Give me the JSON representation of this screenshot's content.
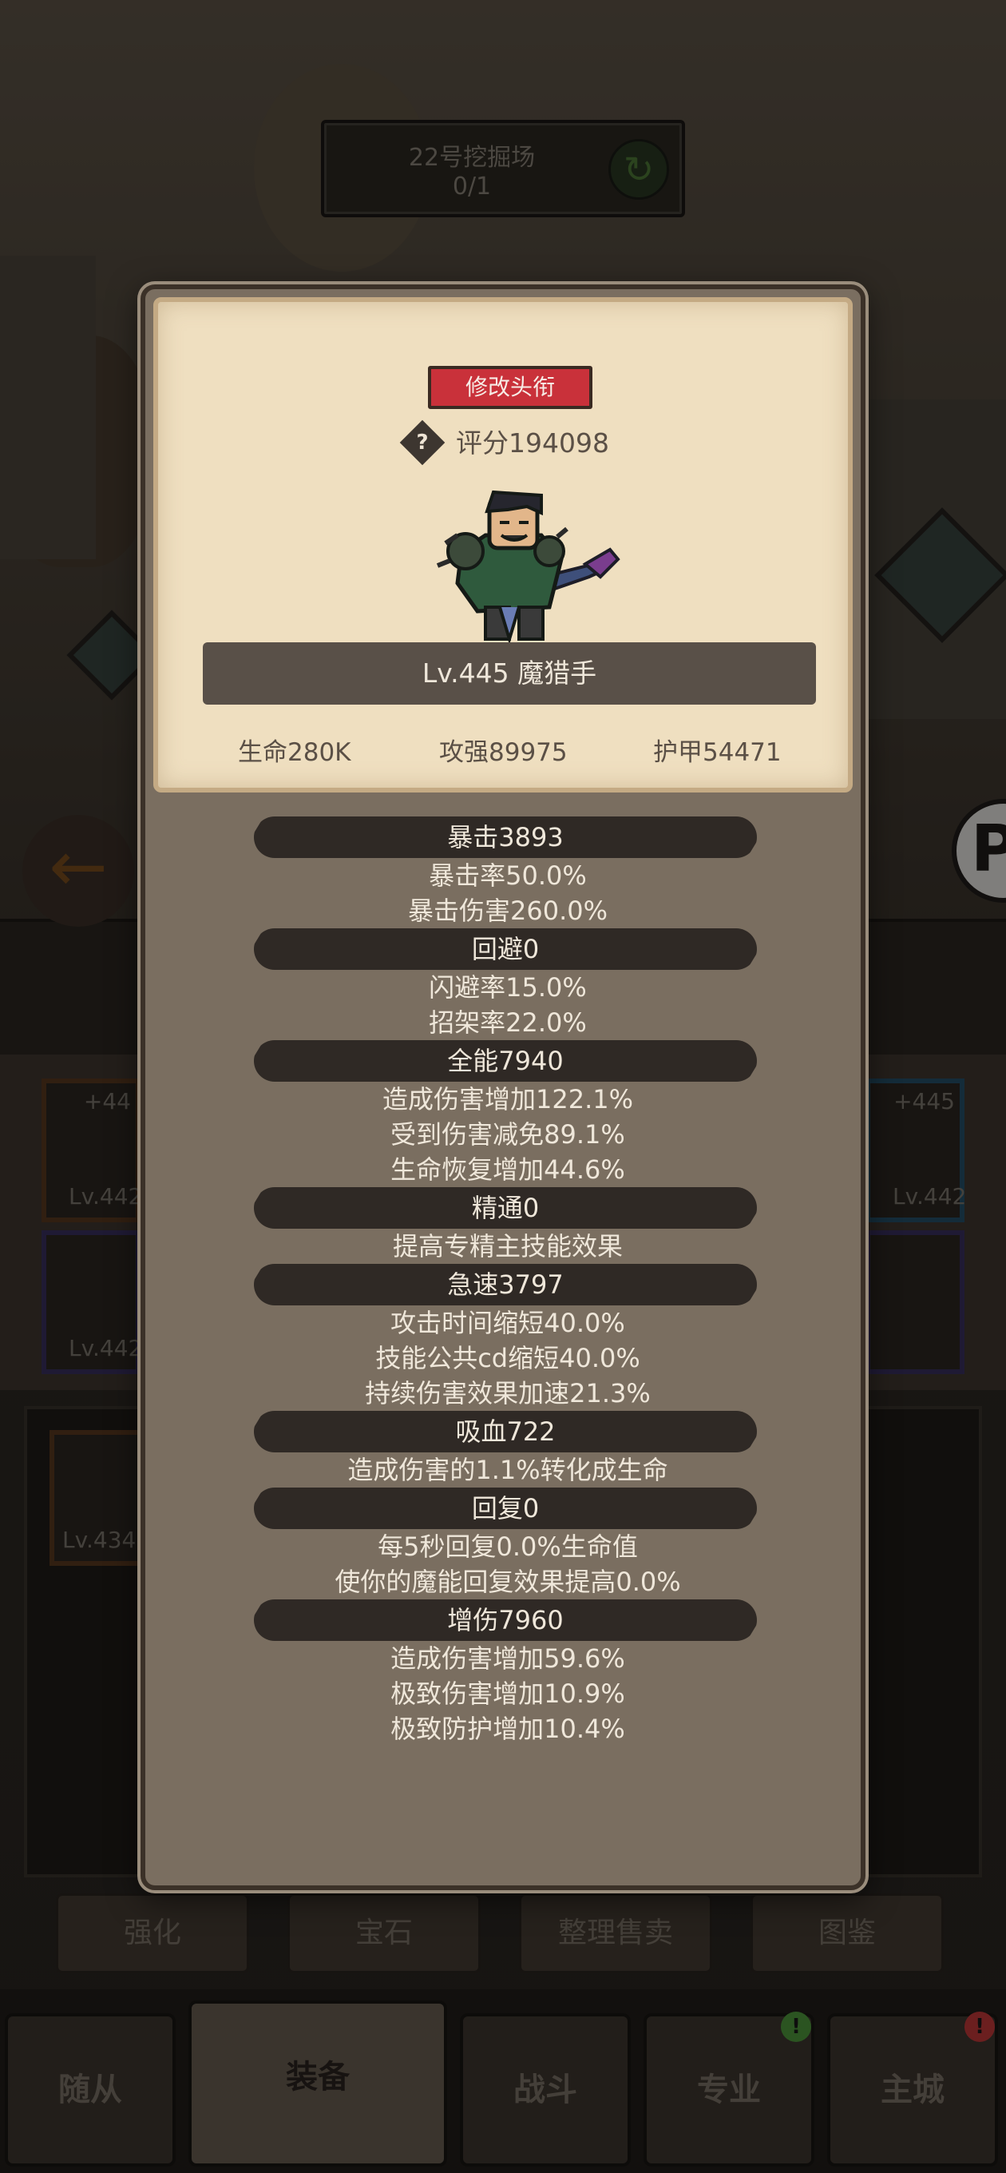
{
  "background": {
    "dig_site": {
      "title": "22号挖掘场",
      "progress": "0/1",
      "refresh_icon": "refresh-icon"
    },
    "equip_slots_left": [
      {
        "plus": "+44",
        "level": "Lv.442"
      },
      {
        "plus": "",
        "level": "Lv.442"
      }
    ],
    "equip_slots_right": [
      {
        "plus": "+445",
        "level": "Lv.442"
      },
      {
        "plus": "",
        "level": ""
      }
    ],
    "bag_slot": {
      "level": "Lv.434"
    },
    "actions": [
      "强化",
      "宝石",
      "整理售卖",
      "图鉴"
    ],
    "bottom_nav": [
      "随从",
      "装备",
      "战斗",
      "专业",
      "主城"
    ],
    "badges": {
      "pro": "!",
      "city": "!"
    }
  },
  "card": {
    "title_button": "修改头衔",
    "score": "评分194098",
    "help": "?",
    "name": "Lv.445 魔猎手",
    "stats": {
      "hp": "生命280K",
      "attack": "攻强89975",
      "armor": "护甲54471"
    }
  },
  "attributes": [
    {
      "header": "暴击3893",
      "lines": [
        "暴击率50.0%",
        "暴击伤害260.0%"
      ]
    },
    {
      "header": "回避0",
      "lines": [
        "闪避率15.0%",
        "招架率22.0%"
      ]
    },
    {
      "header": "全能7940",
      "lines": [
        "造成伤害增加122.1%",
        "受到伤害减免89.1%",
        "生命恢复增加44.6%"
      ]
    },
    {
      "header": "精通0",
      "lines": [
        "提高专精主技能效果"
      ]
    },
    {
      "header": "急速3797",
      "lines": [
        "攻击时间缩短40.0%",
        "技能公共cd缩短40.0%",
        "持续伤害效果加速21.3%"
      ]
    },
    {
      "header": "吸血722",
      "lines": [
        "造成伤害的1.1%转化成生命"
      ]
    },
    {
      "header": "回复0",
      "lines": [
        "每5秒回复0.0%生命值",
        "使你的魔能回复效果提高0.0%"
      ]
    },
    {
      "header": "增伤7960",
      "lines": [
        "造成伤害增加59.6%",
        "极致伤害增加10.9%",
        "极致防护增加10.4%"
      ]
    }
  ]
}
